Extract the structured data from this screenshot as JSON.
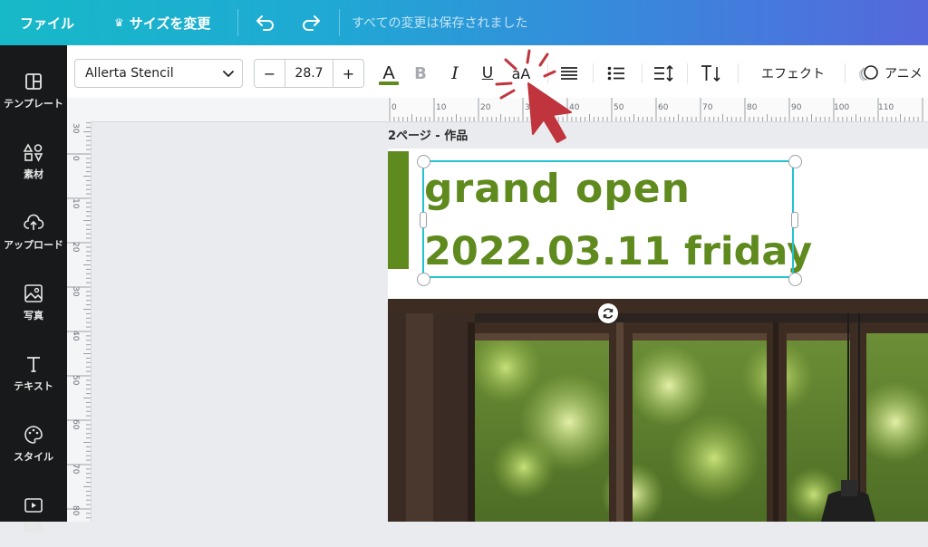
{
  "header": {
    "file_label": "ファイル",
    "resize_label": "サイズを変更",
    "status": "すべての変更は保存されました"
  },
  "sidebar": {
    "items": [
      {
        "label": "テンプレート",
        "icon": "template-icon"
      },
      {
        "label": "素材",
        "icon": "elements-icon"
      },
      {
        "label": "アップロード",
        "icon": "upload-icon"
      },
      {
        "label": "写真",
        "icon": "photo-icon"
      },
      {
        "label": "テキスト",
        "icon": "text-icon"
      },
      {
        "label": "スタイル",
        "icon": "style-icon"
      },
      {
        "label": "動画",
        "icon": "video-icon"
      }
    ]
  },
  "toolbar": {
    "font_name": "Allerta Stencil",
    "font_size": "28.7",
    "minus": "−",
    "plus": "+",
    "color_letter": "A",
    "text_color": "#5f8a1d",
    "bold": "B",
    "italic": "I",
    "underline": "U",
    "case": "aA",
    "effects_label": "エフェクト",
    "animate_label": "アニメ"
  },
  "rulers": {
    "top": [
      "0",
      "10",
      "20",
      "30",
      "40",
      "50",
      "60",
      "70",
      "80",
      "90",
      "100",
      "110"
    ],
    "left": [
      "30",
      "0",
      "10",
      "20",
      "30",
      "40",
      "50",
      "60",
      "70",
      "80"
    ]
  },
  "page": {
    "label": "2ページ - 作品"
  },
  "design": {
    "line1": "grand open",
    "line2": "2022.03.11 friday"
  },
  "colors": {
    "accent": "#5f8a1d",
    "selection": "#22c3d0",
    "annotation": "#c0353d"
  }
}
